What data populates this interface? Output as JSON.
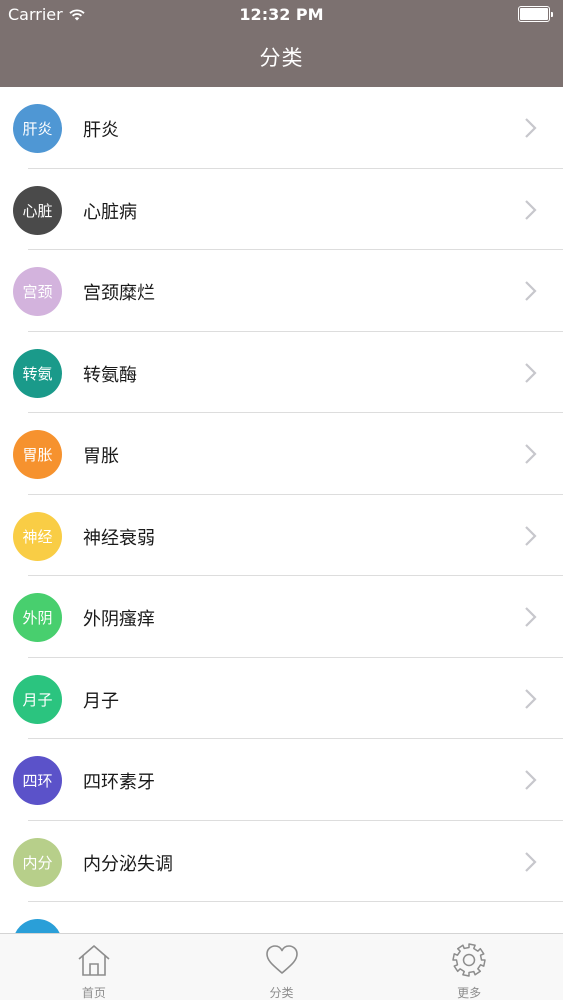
{
  "status_bar": {
    "carrier": "Carrier",
    "time": "12:32 PM"
  },
  "nav": {
    "title": "分类"
  },
  "categories": [
    {
      "icon_text": "肝炎",
      "label": "肝炎",
      "color": "#4f97d4"
    },
    {
      "icon_text": "心脏",
      "label": "心脏病",
      "color": "#4a4a4a"
    },
    {
      "icon_text": "宫颈",
      "label": "宫颈糜烂",
      "color": "#d3b3dd"
    },
    {
      "icon_text": "转氨",
      "label": "转氨酶",
      "color": "#1a9a8a"
    },
    {
      "icon_text": "胃胀",
      "label": "胃胀",
      "color": "#f6922e"
    },
    {
      "icon_text": "神经",
      "label": "神经衰弱",
      "color": "#f9cd45"
    },
    {
      "icon_text": "外阴",
      "label": "外阴瘙痒",
      "color": "#48cf6e"
    },
    {
      "icon_text": "月子",
      "label": "月子",
      "color": "#2bc47f"
    },
    {
      "icon_text": "四环",
      "label": "四环素牙",
      "color": "#5b52c9"
    },
    {
      "icon_text": "内分",
      "label": "内分泌失调",
      "color": "#b7cf8a"
    },
    {
      "icon_text": "",
      "label": "",
      "color": "#2a9fd8"
    }
  ],
  "tabbar": {
    "tabs": [
      {
        "label": "首页",
        "icon": "home-icon"
      },
      {
        "label": "分类",
        "icon": "heart-icon"
      },
      {
        "label": "更多",
        "icon": "gear-icon"
      }
    ]
  },
  "colors": {
    "header": "#7c7170",
    "chevron": "#c7c7cc",
    "tab_icon": "#8d8d8d"
  }
}
